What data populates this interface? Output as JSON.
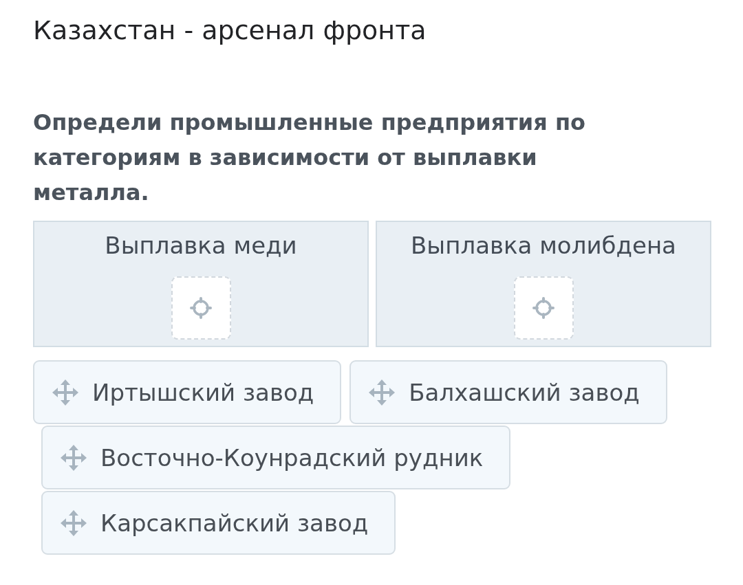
{
  "title": "Казахстан - арсенал фронта",
  "question": "Определи промышленные предприятия по категориям в зависимости от выплавки металла.",
  "categories": [
    {
      "label": "Выплавка меди"
    },
    {
      "label": "Выплавка молибдена"
    }
  ],
  "items": [
    {
      "label": "Иртышский завод"
    },
    {
      "label": "Балхашский завод"
    },
    {
      "label": "Восточно-Коунрадский рудник"
    },
    {
      "label": "Карсакпайский завод"
    }
  ]
}
